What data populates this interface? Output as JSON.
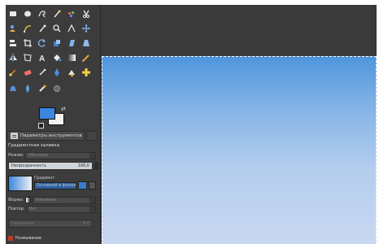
{
  "toolbox": {
    "tools": [
      {
        "icon": "rect-select-icon"
      },
      {
        "icon": "ellipse-select-icon"
      },
      {
        "icon": "free-select-icon"
      },
      {
        "icon": "fuzzy-select-icon"
      },
      {
        "icon": "color-select-icon"
      },
      {
        "icon": "scissors-select-icon"
      },
      {
        "icon": "foreground-select-icon"
      },
      {
        "icon": "paths-icon"
      },
      {
        "icon": "color-picker-icon"
      },
      {
        "icon": "zoom-icon"
      },
      {
        "icon": "measure-icon"
      },
      {
        "icon": "move-icon"
      },
      {
        "icon": "align-icon"
      },
      {
        "icon": "crop-icon"
      },
      {
        "icon": "rotate-icon"
      },
      {
        "icon": "scale-icon"
      },
      {
        "icon": "shear-icon"
      },
      {
        "icon": "perspective-icon"
      },
      {
        "icon": "flip-icon"
      },
      {
        "icon": "cage-icon"
      },
      {
        "icon": "text-icon"
      },
      {
        "icon": "bucket-fill-icon"
      },
      {
        "icon": "blend-icon"
      },
      {
        "icon": "pencil-icon"
      },
      {
        "icon": "paintbrush-icon"
      },
      {
        "icon": "eraser-icon"
      },
      {
        "icon": "airbrush-icon"
      },
      {
        "icon": "ink-icon"
      },
      {
        "icon": "clone-icon"
      },
      {
        "icon": "heal-icon"
      },
      {
        "icon": "perspective-clone-icon"
      },
      {
        "icon": "blur-icon"
      },
      {
        "icon": "smudge-icon"
      },
      {
        "icon": "dodge-burn-icon"
      }
    ],
    "colors": {
      "foreground": "#3b86de",
      "background": "#f2f2f2"
    }
  },
  "tool_options": {
    "tab_label": "Параметры инструментов",
    "title": "Градиентная заливка",
    "mode_label": "Режим:",
    "mode_value": "Обычный",
    "opacity_label": "Непрозрачность",
    "opacity_value": "100,0",
    "gradient_label": "Градиент",
    "gradient_value": "Основной в фоновый",
    "shape_label": "Форма:",
    "shape_value": "Линейная",
    "repeat_label": "Повтор:",
    "repeat_value": "Нет",
    "offset_label": "Смещение",
    "offset_value": "0,0",
    "adaptive_label": "Размывание"
  },
  "canvas": {
    "gradient_top": "#4f95dc",
    "gradient_bottom": "#c9d8f1",
    "background": "#3a3a3a"
  }
}
